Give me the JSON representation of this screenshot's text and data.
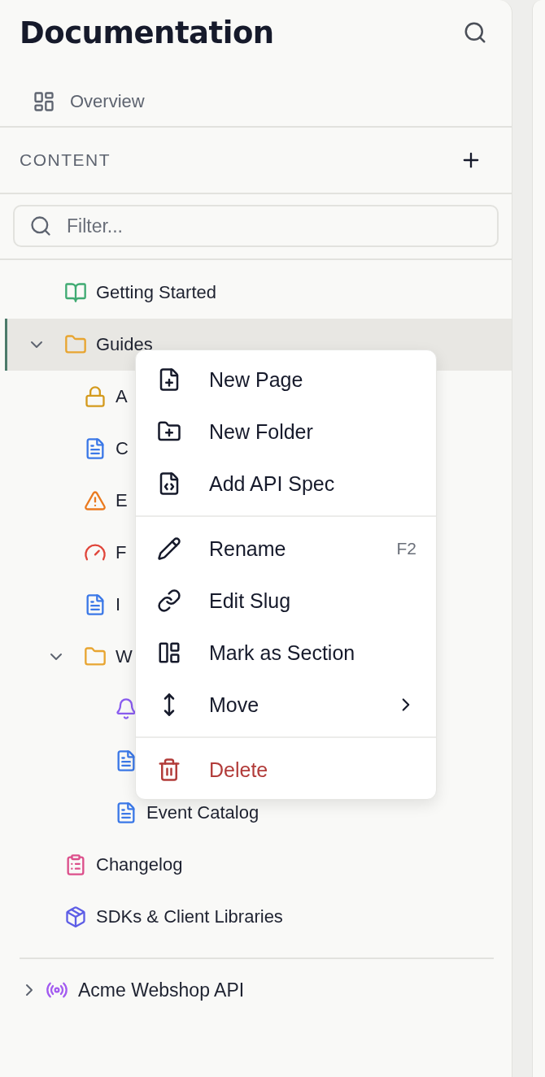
{
  "sidebar": {
    "title": "Documentation",
    "overview": {
      "label": "Overview"
    },
    "section_label": "CONTENT",
    "filter": {
      "placeholder": "Filter..."
    },
    "tree": [
      {
        "label": "Getting Started",
        "kind": "book",
        "selected": false
      },
      {
        "label": "Guides",
        "kind": "folder",
        "selected": true,
        "expanded": true,
        "children": [
          {
            "label": "A",
            "kind": "lock",
            "selected": false
          },
          {
            "label": "C",
            "kind": "doc",
            "selected": false
          },
          {
            "label": "E",
            "kind": "warning",
            "selected": false
          },
          {
            "label": "F",
            "kind": "gauge",
            "selected": false
          },
          {
            "label": "I",
            "kind": "doc",
            "selected": false
          },
          {
            "label": "W",
            "kind": "folder",
            "selected": false,
            "expanded": true,
            "children": [
              {
                "kind": "bell",
                "selected": false
              },
              {
                "kind": "doc",
                "selected": false
              },
              {
                "label": "Event Catalog",
                "kind": "doc",
                "selected": false
              }
            ]
          }
        ]
      },
      {
        "label": "Changelog",
        "kind": "clipboard",
        "selected": false
      },
      {
        "label": "SDKs & Client Libraries",
        "kind": "package",
        "selected": false
      }
    ],
    "apis": [
      {
        "label": "Acme Webshop API",
        "kind": "api",
        "expanded": false
      }
    ]
  },
  "context_menu": {
    "groups": [
      [
        {
          "label": "New Page",
          "kind": "page"
        },
        {
          "label": "New Folder",
          "kind": "folder"
        },
        {
          "label": "Add API Spec",
          "kind": "spec"
        }
      ],
      [
        {
          "label": "Rename",
          "kind": "rename",
          "shortcut": "F2"
        },
        {
          "label": "Edit Slug",
          "kind": "link"
        },
        {
          "label": "Mark as Section",
          "kind": "section"
        },
        {
          "label": "Move",
          "kind": "move",
          "has_submenu": true
        }
      ],
      [
        {
          "label": "Delete",
          "kind": "delete"
        }
      ]
    ]
  }
}
